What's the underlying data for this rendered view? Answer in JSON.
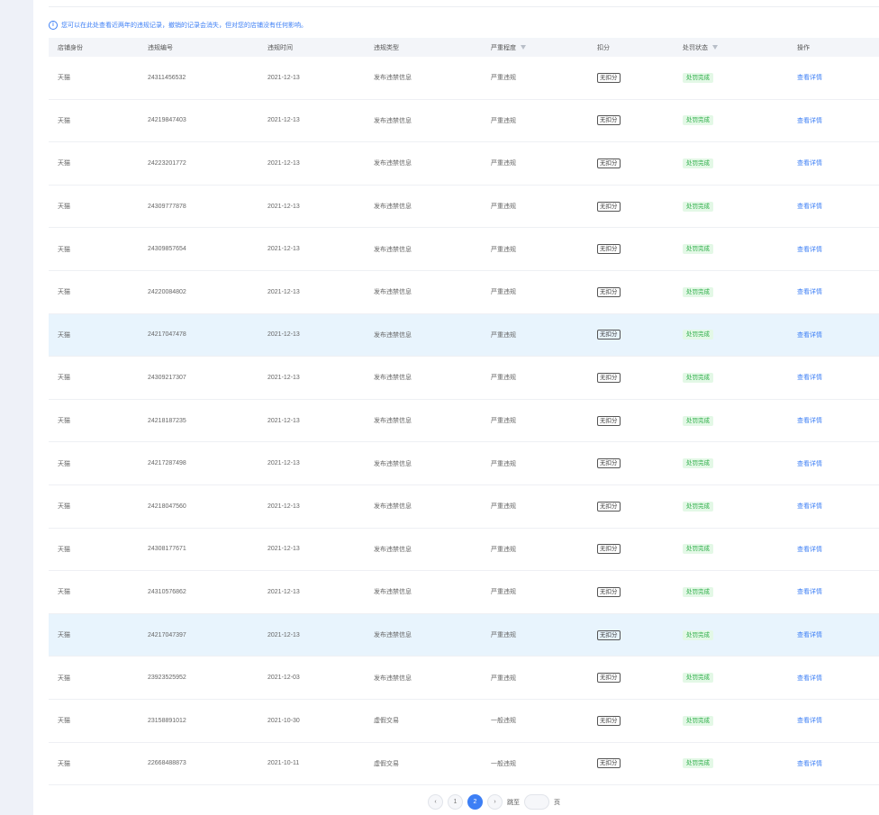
{
  "notice": {
    "icon": "info-icon",
    "text": "您可以在此处查看近两年的违规记录，撤销的记录会消失，但对您的店铺没有任何影响。"
  },
  "table": {
    "headers": [
      "店铺身份",
      "违规编号",
      "违规时间",
      "违规类型",
      "严重程度",
      "扣分",
      "处罚状态",
      "操作"
    ],
    "rows": [
      {
        "shop": "天猫",
        "id": "24311456532",
        "time": "2021-12-13",
        "type": "发布违禁信息",
        "level": "严重违规",
        "deduct": "无扣分",
        "status": "处罚完成",
        "op": "查看详情"
      },
      {
        "shop": "天猫",
        "id": "24219847403",
        "time": "2021-12-13",
        "type": "发布违禁信息",
        "level": "严重违规",
        "deduct": "无扣分",
        "status": "处罚完成",
        "op": "查看详情"
      },
      {
        "shop": "天猫",
        "id": "24223201772",
        "time": "2021-12-13",
        "type": "发布违禁信息",
        "level": "严重违规",
        "deduct": "无扣分",
        "status": "处罚完成",
        "op": "查看详情"
      },
      {
        "shop": "天猫",
        "id": "24309777878",
        "time": "2021-12-13",
        "type": "发布违禁信息",
        "level": "严重违规",
        "deduct": "无扣分",
        "status": "处罚完成",
        "op": "查看详情"
      },
      {
        "shop": "天猫",
        "id": "24309857654",
        "time": "2021-12-13",
        "type": "发布违禁信息",
        "level": "严重违规",
        "deduct": "无扣分",
        "status": "处罚完成",
        "op": "查看详情"
      },
      {
        "shop": "天猫",
        "id": "24220084802",
        "time": "2021-12-13",
        "type": "发布违禁信息",
        "level": "严重违规",
        "deduct": "无扣分",
        "status": "处罚完成",
        "op": "查看详情"
      },
      {
        "shop": "天猫",
        "id": "24217047478",
        "time": "2021-12-13",
        "type": "发布违禁信息",
        "level": "严重违规",
        "deduct": "无扣分",
        "status": "处罚完成",
        "op": "查看详情"
      },
      {
        "shop": "天猫",
        "id": "24309217307",
        "time": "2021-12-13",
        "type": "发布违禁信息",
        "level": "严重违规",
        "deduct": "无扣分",
        "status": "处罚完成",
        "op": "查看详情"
      },
      {
        "shop": "天猫",
        "id": "24218187235",
        "time": "2021-12-13",
        "type": "发布违禁信息",
        "level": "严重违规",
        "deduct": "无扣分",
        "status": "处罚完成",
        "op": "查看详情"
      },
      {
        "shop": "天猫",
        "id": "24217287498",
        "time": "2021-12-13",
        "type": "发布违禁信息",
        "level": "严重违规",
        "deduct": "无扣分",
        "status": "处罚完成",
        "op": "查看详情"
      },
      {
        "shop": "天猫",
        "id": "24218047560",
        "time": "2021-12-13",
        "type": "发布违禁信息",
        "level": "严重违规",
        "deduct": "无扣分",
        "status": "处罚完成",
        "op": "查看详情"
      },
      {
        "shop": "天猫",
        "id": "24308177671",
        "time": "2021-12-13",
        "type": "发布违禁信息",
        "level": "严重违规",
        "deduct": "无扣分",
        "status": "处罚完成",
        "op": "查看详情"
      },
      {
        "shop": "天猫",
        "id": "24310576862",
        "time": "2021-12-13",
        "type": "发布违禁信息",
        "level": "严重违规",
        "deduct": "无扣分",
        "status": "处罚完成",
        "op": "查看详情"
      },
      {
        "shop": "天猫",
        "id": "24217047397",
        "time": "2021-12-13",
        "type": "发布违禁信息",
        "level": "严重违规",
        "deduct": "无扣分",
        "status": "处罚完成",
        "op": "查看详情"
      },
      {
        "shop": "天猫",
        "id": "23923525952",
        "time": "2021-12-03",
        "type": "发布违禁信息",
        "level": "严重违规",
        "deduct": "无扣分",
        "status": "处罚完成",
        "op": "查看详情"
      },
      {
        "shop": "天猫",
        "id": "23158891012",
        "time": "2021-10-30",
        "type": "虚假交易",
        "level": "一般违规",
        "deduct": "无扣分",
        "status": "处罚完成",
        "op": "查看详情"
      },
      {
        "shop": "天猫",
        "id": "22668488873",
        "time": "2021-10-11",
        "type": "虚假交易",
        "level": "一般违规",
        "deduct": "无扣分",
        "status": "处罚完成",
        "op": "查看详情"
      }
    ],
    "highlighted_rows": [
      6,
      13
    ]
  },
  "pagination": {
    "pages": [
      "1",
      "2"
    ],
    "current": "2",
    "goto_label": "跳至",
    "page_unit": "页"
  },
  "colors": {
    "accent": "#3d7ff5",
    "success": "#2fae4a",
    "highlight_row": "#e8f4fd"
  }
}
